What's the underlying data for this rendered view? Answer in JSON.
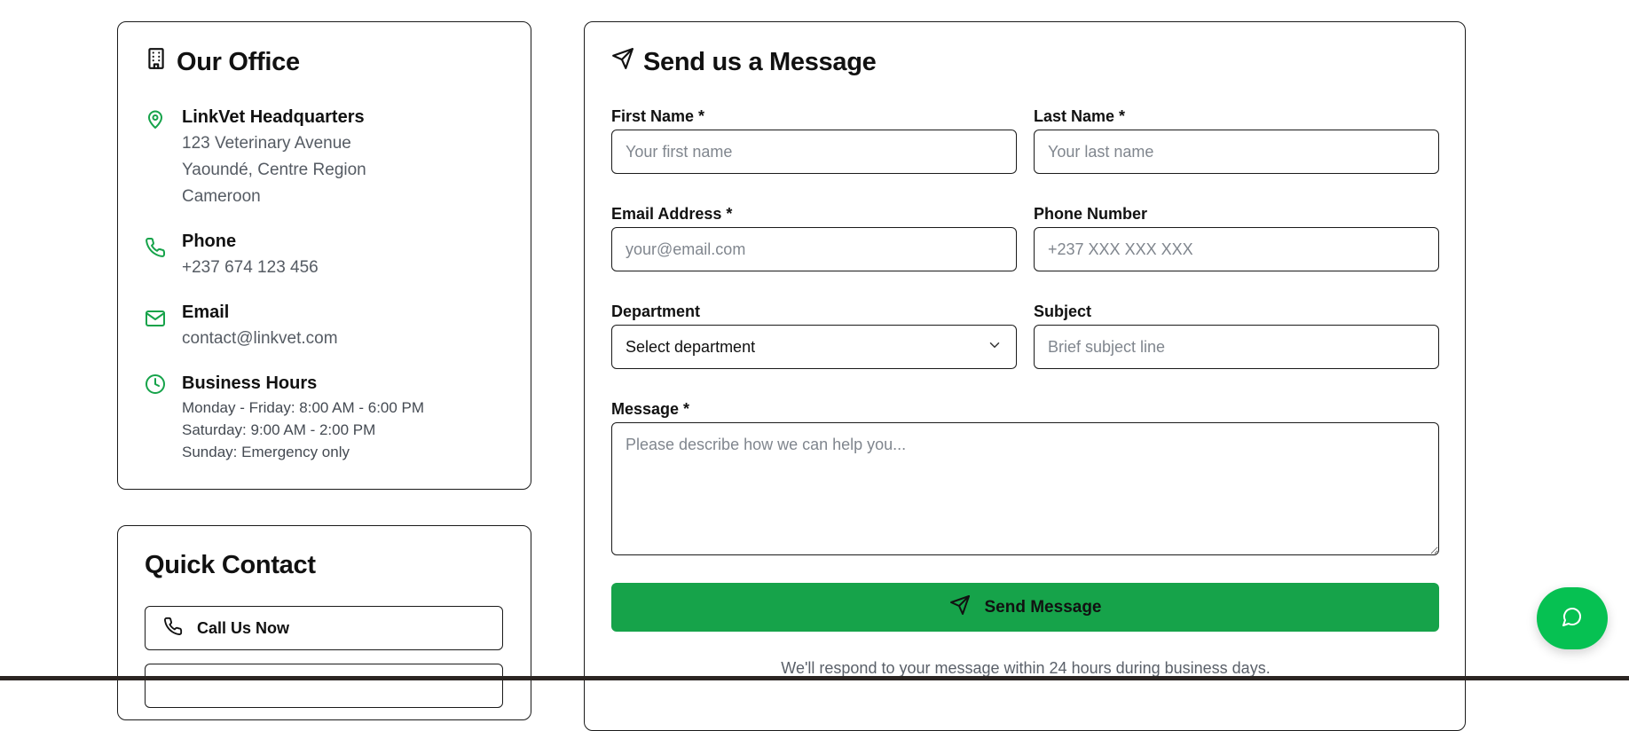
{
  "office": {
    "title": "Our Office",
    "icon": "building-icon",
    "address": {
      "title": "LinkVet Headquarters",
      "lines": [
        "123 Veterinary Avenue",
        "Yaoundé, Centre Region",
        "Cameroon"
      ],
      "icon": "map-pin-icon"
    },
    "phone": {
      "title": "Phone",
      "value": "+237 674 123 456",
      "icon": "phone-icon"
    },
    "email": {
      "title": "Email",
      "value": "contact@linkvet.com",
      "icon": "mail-icon"
    },
    "hours": {
      "title": "Business Hours",
      "lines": [
        "Monday - Friday: 8:00 AM - 6:00 PM",
        "Saturday: 9:00 AM - 2:00 PM",
        "Sunday: Emergency only"
      ],
      "icon": "clock-icon"
    },
    "accent_color": "#16a34a"
  },
  "quick_contact": {
    "title": "Quick Contact",
    "call_label": "Call Us Now"
  },
  "message_form": {
    "title": "Send us a Message",
    "first_name": {
      "label": "First Name *",
      "placeholder": "Your first name"
    },
    "last_name": {
      "label": "Last Name *",
      "placeholder": "Your last name"
    },
    "email": {
      "label": "Email Address *",
      "placeholder": "your@email.com"
    },
    "phone": {
      "label": "Phone Number",
      "placeholder": "+237 XXX XXX XXX"
    },
    "department": {
      "label": "Department",
      "value": "Select department"
    },
    "subject": {
      "label": "Subject",
      "placeholder": "Brief subject line"
    },
    "message": {
      "label": "Message *",
      "placeholder": "Please describe how we can help you..."
    },
    "submit_label": "Send Message",
    "submit_color": "#16a34a",
    "respond_note": "We'll respond to your message within 24 hours during business days."
  },
  "chat_fab": {
    "icon": "chat-bubble-icon",
    "color": "#06c152"
  }
}
